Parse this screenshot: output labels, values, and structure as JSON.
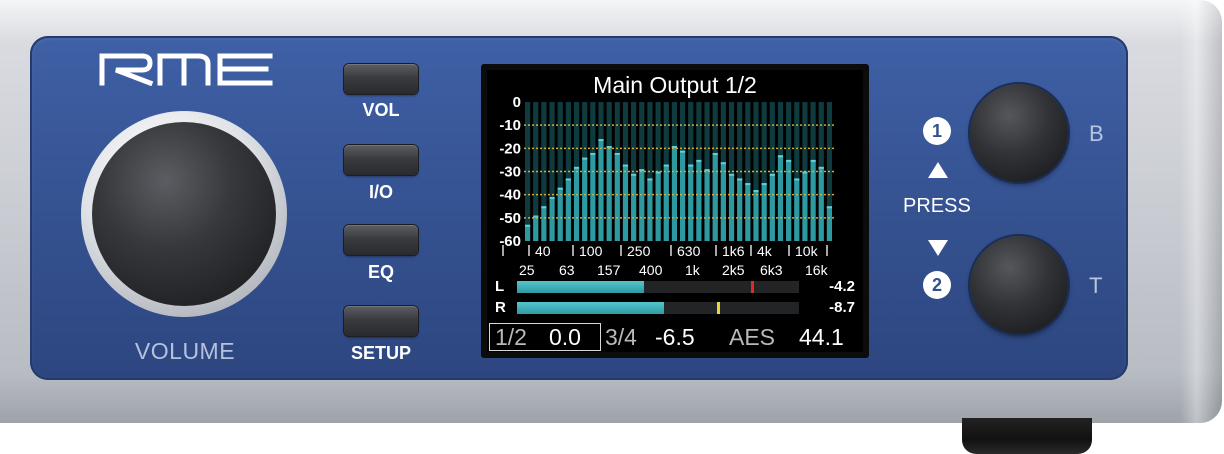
{
  "brand": {
    "logo_text": "RME"
  },
  "volume": {
    "label": "VOLUME"
  },
  "buttons": [
    {
      "id": "vol",
      "label": "VOL"
    },
    {
      "id": "io",
      "label": "I/O"
    },
    {
      "id": "eq",
      "label": "EQ"
    },
    {
      "id": "setup",
      "label": "SETUP"
    }
  ],
  "display": {
    "title": "Main Output 1/2",
    "db_scale": [
      "0",
      "-10",
      "-20",
      "-30",
      "-40",
      "-50",
      "-60"
    ],
    "freq_top": [
      "40",
      "100",
      "250",
      "630",
      "1k6",
      "4k",
      "10k"
    ],
    "freq_bottom": [
      "25",
      "63",
      "157",
      "400",
      "1k",
      "2k5",
      "6k3",
      "16k"
    ],
    "spectrum_db": [
      -53,
      -49,
      -45,
      -41,
      -37,
      -33,
      -28,
      -24,
      -22,
      -16,
      -19,
      -22,
      -27,
      -31,
      -29,
      -33,
      -30,
      -27,
      -19,
      -21,
      -27,
      -25,
      -29,
      -22,
      -26,
      -31,
      -33,
      -35,
      -38,
      -35,
      -31,
      -23,
      -25,
      -33,
      -30,
      -25,
      -28,
      -45
    ],
    "colors": {
      "bar": "#2d9aa2",
      "bar_top": "#5fd0d6",
      "grid_line": "#d4a93a",
      "background": "#000000"
    },
    "meters": [
      {
        "channel": "L",
        "level_fraction": 0.45,
        "peak_fraction": 0.83,
        "peak_color": "#e02a2a",
        "value": "-4.2"
      },
      {
        "channel": "R",
        "level_fraction": 0.52,
        "peak_fraction": 0.71,
        "peak_color": "#e6d63a",
        "value": "-8.7"
      }
    ],
    "status": {
      "ch1": "1/2",
      "val1": "0.0",
      "ch2": "3/4",
      "val2": "-6.5",
      "source": "AES",
      "rate": "44.1"
    }
  },
  "encoders": {
    "top": {
      "number": "1",
      "side_label": "B"
    },
    "bottom": {
      "number": "2",
      "side_label": "T"
    },
    "press_label": "PRESS"
  }
}
